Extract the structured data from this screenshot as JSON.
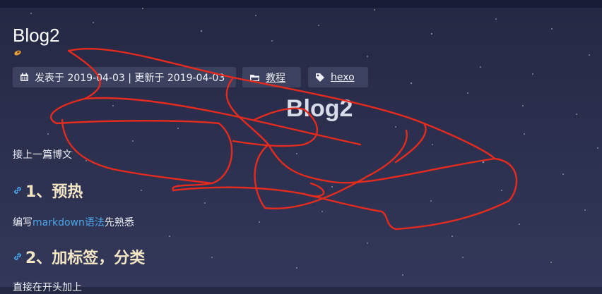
{
  "post": {
    "title": "Blog2",
    "meta": {
      "date_text": "发表于 2019-04-03 | 更新于 2019-04-03",
      "category": "教程",
      "tag": "hexo"
    },
    "banner_title": "Blog2",
    "intro": "接上一篇博文",
    "sections": [
      {
        "heading": "1、预热",
        "text_before": "编写",
        "link_text": "markdown语法",
        "text_after": "先熟悉"
      },
      {
        "heading": "2、加标签，分类",
        "text": "直接在开头加上"
      }
    ]
  },
  "colors": {
    "background": "#2d3150",
    "heading": "#f3e6c4",
    "link": "#4aa8ea",
    "annotation": "#e52a1e"
  },
  "icons": [
    "calendar-icon",
    "folder-icon",
    "tag-icon",
    "link-icon"
  ]
}
